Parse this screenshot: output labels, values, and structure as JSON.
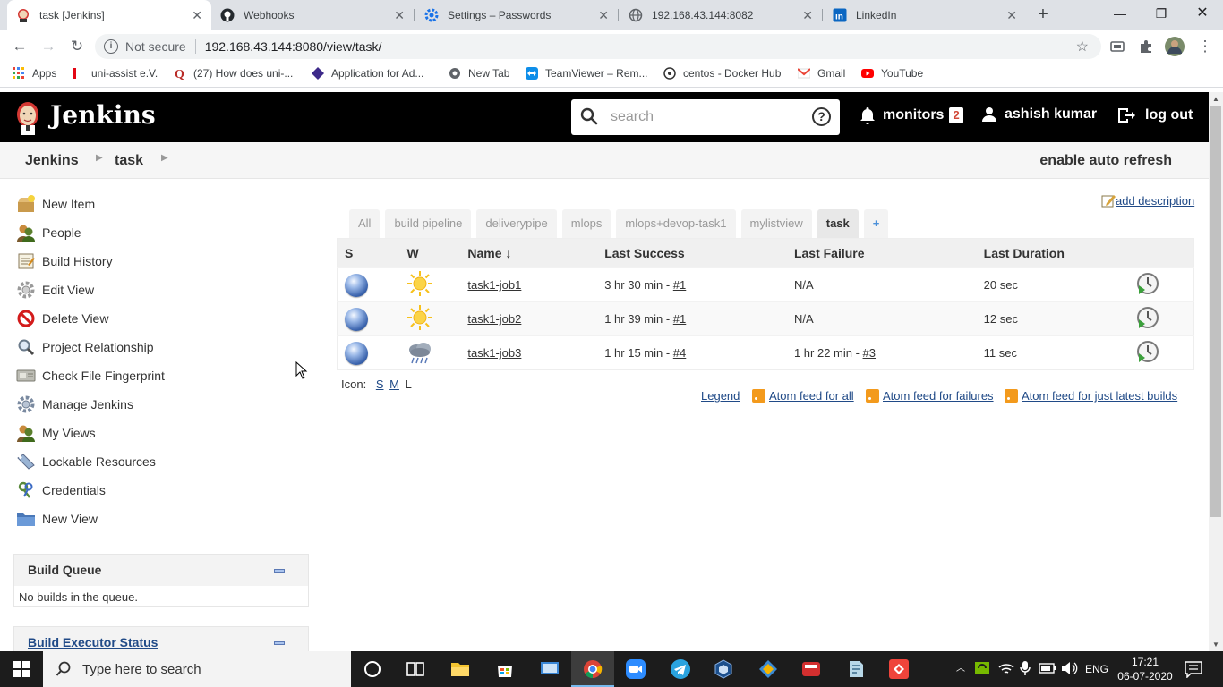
{
  "browser": {
    "tabs": [
      {
        "title": "task [Jenkins]",
        "active": true
      },
      {
        "title": "Webhooks",
        "active": false
      },
      {
        "title": "Settings – Passwords",
        "active": false
      },
      {
        "title": "192.168.43.144:8082",
        "active": false
      },
      {
        "title": "LinkedIn",
        "active": false
      }
    ],
    "security_label": "Not secure",
    "url": "192.168.43.144:8080/view/task/",
    "bookmarks": [
      "Apps",
      "uni-assist e.V.",
      "(27) How does uni-...",
      "Application for Ad...",
      "New Tab",
      "TeamViewer – Rem...",
      "centos - Docker Hub",
      "Gmail",
      "YouTube"
    ]
  },
  "header": {
    "title": "Jenkins",
    "search_placeholder": "search",
    "help": "?",
    "monitors_label": "monitors",
    "monitors_count": "2",
    "user": "ashish kumar",
    "logout": "log out"
  },
  "breadcrumb": {
    "items": [
      "Jenkins",
      "task"
    ],
    "auto_refresh": "enable auto refresh"
  },
  "sidebar": {
    "tasks": [
      "New Item",
      "People",
      "Build History",
      "Edit View",
      "Delete View",
      "Project Relationship",
      "Check File Fingerprint",
      "Manage Jenkins",
      "My Views",
      "Lockable Resources",
      "Credentials",
      "New View"
    ],
    "build_queue": {
      "title": "Build Queue",
      "empty": "No builds in the queue."
    },
    "executor_status": {
      "title": "Build Executor Status"
    }
  },
  "main": {
    "add_description": "add description",
    "view_tabs": [
      "All",
      "build pipeline",
      "deliverypipe",
      "mlops",
      "mlops+devop-task1",
      "mylistview",
      "task",
      "+"
    ],
    "active_view": "task",
    "columns": {
      "s": "S",
      "w": "W",
      "name": "Name",
      "sort_arrow": "↓",
      "last_success": "Last Success",
      "last_failure": "Last Failure",
      "last_duration": "Last Duration"
    },
    "jobs": [
      {
        "name": "task1-job1",
        "weather": "sunny",
        "last_success": "3 hr 30 min - ",
        "success_build": "#1",
        "last_failure": "N/A",
        "failure_build": "",
        "last_duration": "20 sec"
      },
      {
        "name": "task1-job2",
        "weather": "sunny",
        "last_success": "1 hr 39 min - ",
        "success_build": "#1",
        "last_failure": "N/A",
        "failure_build": "",
        "last_duration": "12 sec"
      },
      {
        "name": "task1-job3",
        "weather": "storm",
        "last_success": "1 hr 15 min - ",
        "success_build": "#4",
        "last_failure": "1 hr 22 min - ",
        "failure_build": "#3",
        "last_duration": "11 sec"
      }
    ],
    "icon_label": "Icon:",
    "icon_sizes": [
      "S",
      "M",
      "L"
    ],
    "legend": "Legend",
    "feeds": [
      "Atom feed for all",
      "Atom feed for failures",
      "Atom feed for just latest builds"
    ]
  },
  "taskbar": {
    "search_placeholder": "Type here to search",
    "language": "ENG",
    "time": "17:21",
    "date": "06-07-2020"
  },
  "colors": {
    "jenkins_header": "#000000",
    "link": "#204a87",
    "badge_text": "#d24939",
    "status_blue": "#3a63ad"
  }
}
